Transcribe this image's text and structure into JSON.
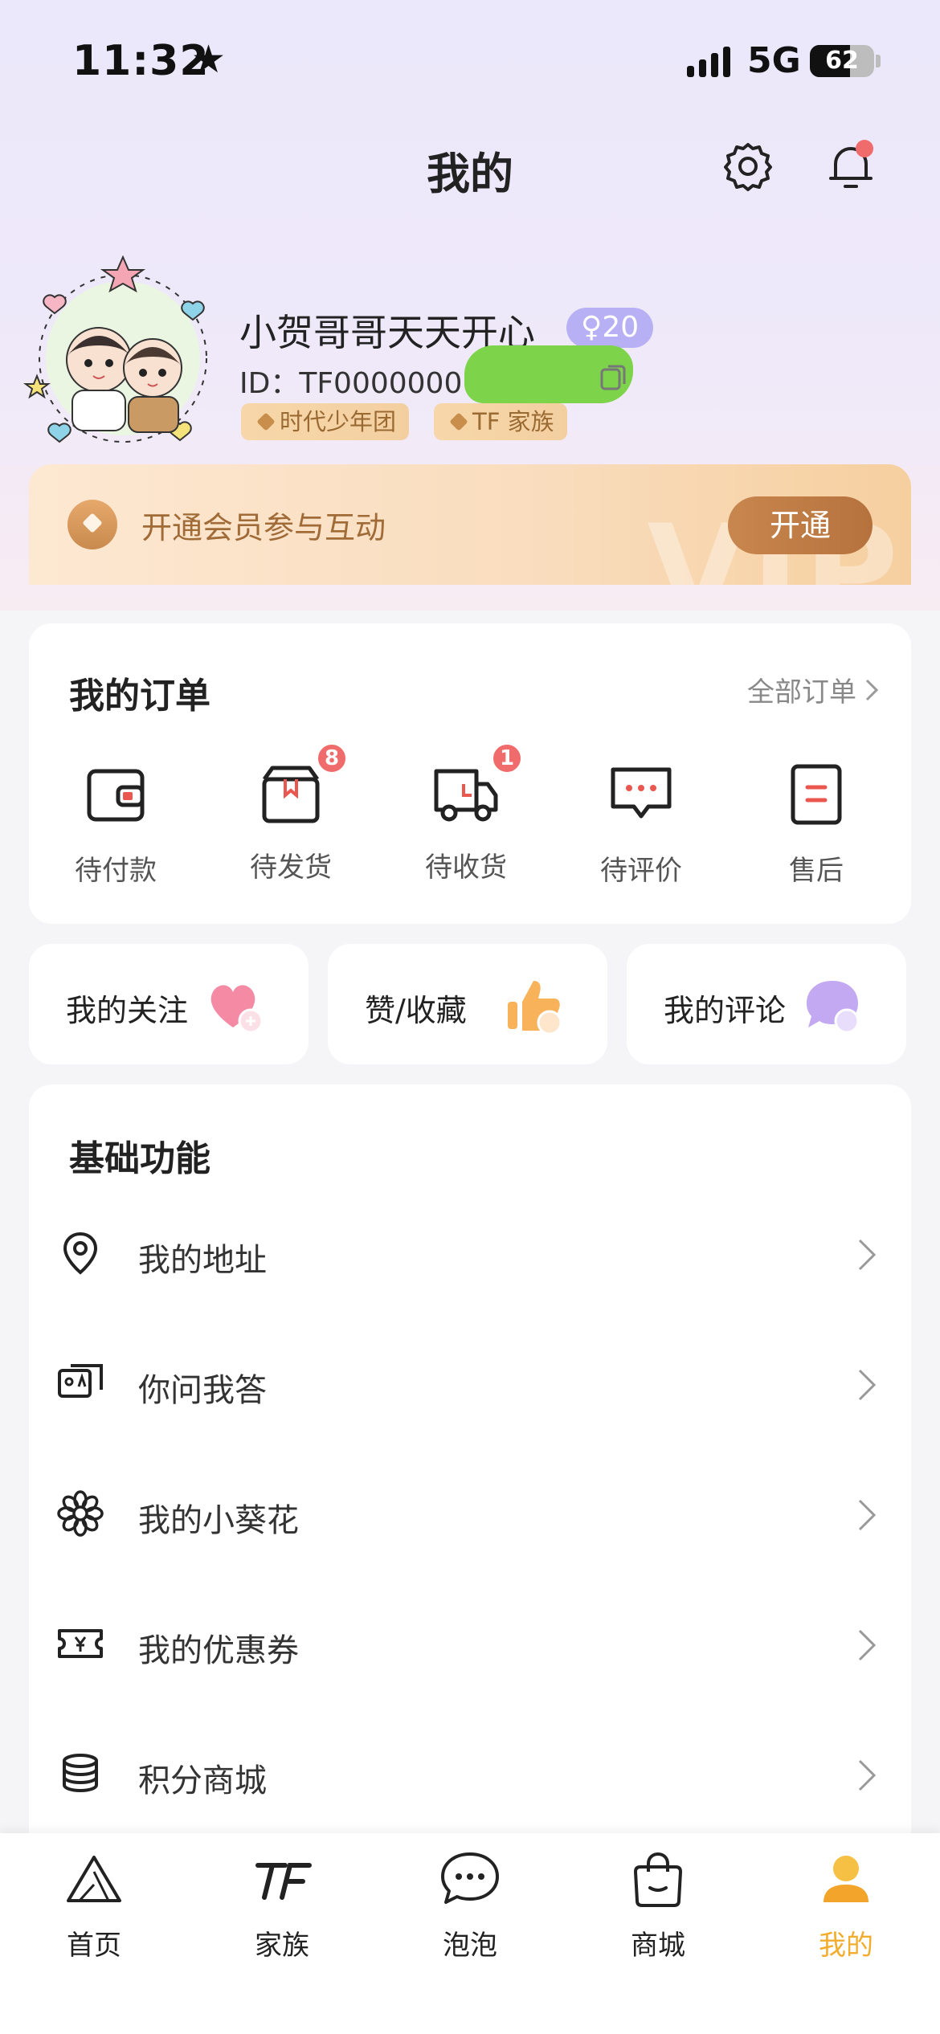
{
  "status_bar": {
    "time": "11:32",
    "network": "5G",
    "battery": "62",
    "battery_level": 0.62
  },
  "header": {
    "title": "我的"
  },
  "profile": {
    "username": "小贺哥哥天天开心",
    "level": "♀20",
    "user_id": "ID：TF0000000",
    "tags": [
      "时代少年团",
      "TF 家族"
    ]
  },
  "vip": {
    "text": "开通会员参与互动",
    "button": "开通",
    "watermark": "VIP"
  },
  "orders": {
    "title": "我的订单",
    "all_label": "全部订单",
    "items": [
      {
        "label": "待付款",
        "badge": ""
      },
      {
        "label": "待发货",
        "badge": "8"
      },
      {
        "label": "待收货",
        "badge": "1"
      },
      {
        "label": "待评价",
        "badge": ""
      },
      {
        "label": "售后",
        "badge": ""
      }
    ]
  },
  "quick_links": [
    {
      "label": "我的关注"
    },
    {
      "label": "赞/收藏"
    },
    {
      "label": "我的评论"
    }
  ],
  "basic": {
    "title": "基础功能",
    "items": [
      {
        "label": "我的地址"
      },
      {
        "label": "你问我答"
      },
      {
        "label": "我的小葵花"
      },
      {
        "label": "我的优惠券"
      },
      {
        "label": "积分商城"
      }
    ]
  },
  "tabbar": {
    "items": [
      {
        "label": "首页"
      },
      {
        "label": "家族"
      },
      {
        "label": "泡泡"
      },
      {
        "label": "商城"
      },
      {
        "label": "我的"
      }
    ],
    "active_color": "#f2ad2e"
  },
  "colors": {
    "accent": "#f2ad2e",
    "badge": "#f06b6b",
    "vip_button": "#b6723d",
    "level_badge": "#b7b0f4"
  }
}
